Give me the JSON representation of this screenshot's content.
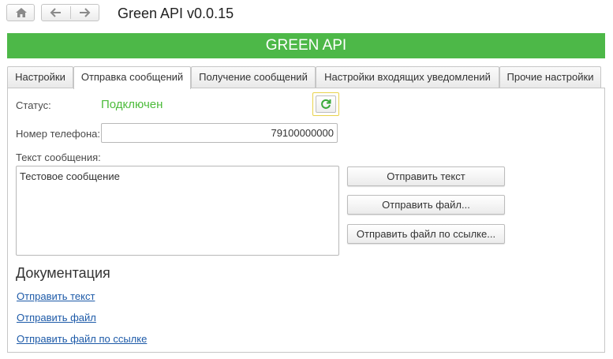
{
  "window": {
    "title": "Green API v0.0.15",
    "banner": "GREEN API"
  },
  "toolbar": {
    "home_icon": "home-icon",
    "back_icon": "arrow-left-icon",
    "forward_icon": "arrow-right-icon"
  },
  "tabs": [
    {
      "label": "Настройки",
      "active": false
    },
    {
      "label": "Отправка сообщений",
      "active": true
    },
    {
      "label": "Получение сообщений",
      "active": false
    },
    {
      "label": "Настройки входящих уведомлений",
      "active": false
    },
    {
      "label": "Прочие настройки",
      "active": false
    }
  ],
  "form": {
    "status_label": "Статус:",
    "status_value": "Подключен",
    "phone_label": "Номер телефона:",
    "phone_value": "79100000000",
    "message_label": "Текст сообщения:",
    "message_value": "Тестовое сообщение"
  },
  "actions": {
    "send_text": "Отправить текст",
    "send_file": "Отправить файл...",
    "send_file_url": "Отправить файл по ссылке..."
  },
  "docs": {
    "heading": "Документация",
    "links": [
      "Отправить текст",
      "Отправить файл",
      "Отправить файл по ссылке"
    ]
  },
  "colors": {
    "banner": "#4db848",
    "status": "#4cbb3a",
    "link": "#1d5aa8",
    "focus": "#e8d24b"
  }
}
